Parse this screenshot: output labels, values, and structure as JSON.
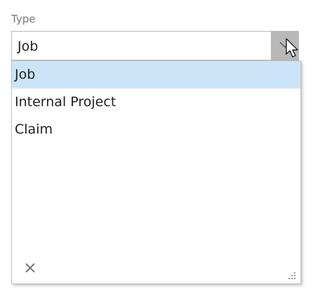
{
  "field": {
    "label": "Type",
    "value": "Job"
  },
  "dropdown": {
    "options": [
      {
        "label": "Job",
        "selected": true
      },
      {
        "label": "Internal Project",
        "selected": false
      },
      {
        "label": "Claim",
        "selected": false
      }
    ]
  },
  "icons": {
    "dropdown_arrow": "chevron-down-icon",
    "clear": "close-icon",
    "resize": "resize-grip-icon",
    "cursor": "mouse-pointer-icon"
  },
  "colors": {
    "selected_background": "#cce4f7",
    "button_hover_background": "#b8b8b8"
  }
}
